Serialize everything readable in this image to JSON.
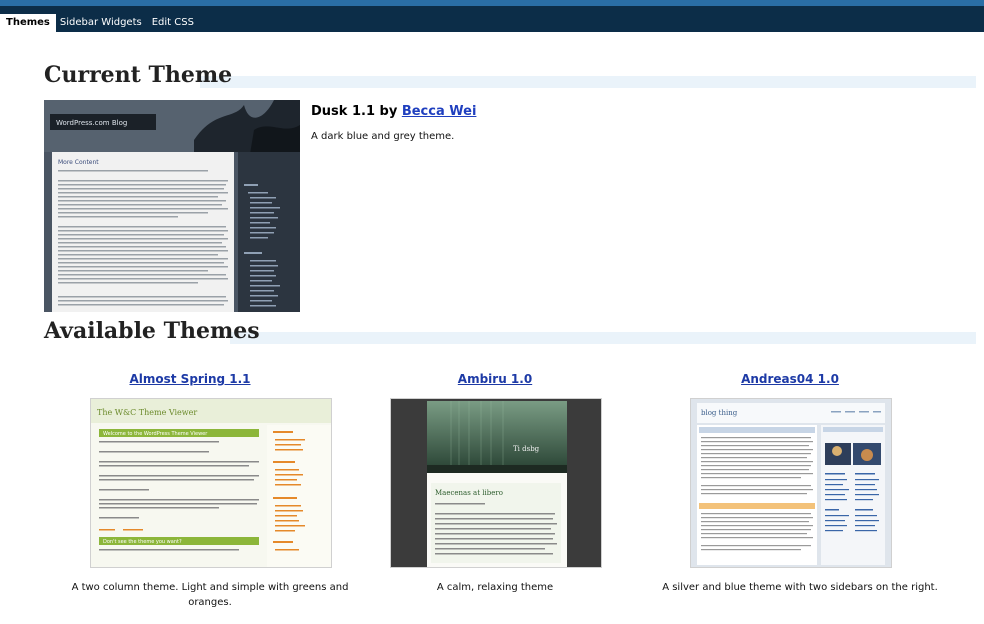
{
  "tabs": [
    {
      "label": "Themes",
      "active": true
    },
    {
      "label": "Sidebar Widgets",
      "active": false
    },
    {
      "label": "Edit CSS",
      "active": false
    }
  ],
  "current_theme": {
    "heading": "Current Theme",
    "name_version": "Dusk 1.1",
    "by": "by",
    "author": "Becca Wei",
    "description": "A dark blue and grey theme.",
    "screenshot": {
      "blog_title": "WordPress.com Blog",
      "post_title": "More Content"
    }
  },
  "available": {
    "heading": "Available Themes",
    "themes": [
      {
        "name": "Almost Spring 1.1",
        "description": "A two column theme. Light and simple with greens and oranges.",
        "screenshot": {
          "header": "The W&C Theme Viewer",
          "banner": "Welcome to the WordPress Theme Viewer",
          "banner2": "Don't see the theme you want?"
        }
      },
      {
        "name": "Ambiru 1.0",
        "description": "A calm, relaxing theme",
        "screenshot": {
          "blog_title": "Ti dsbg",
          "post_title": "Maecenas at libero"
        }
      },
      {
        "name": "Andreas04 1.0",
        "description": "A silver and blue theme with two sidebars on the right.",
        "screenshot": {
          "blog_title": "blog thing"
        }
      }
    ]
  }
}
